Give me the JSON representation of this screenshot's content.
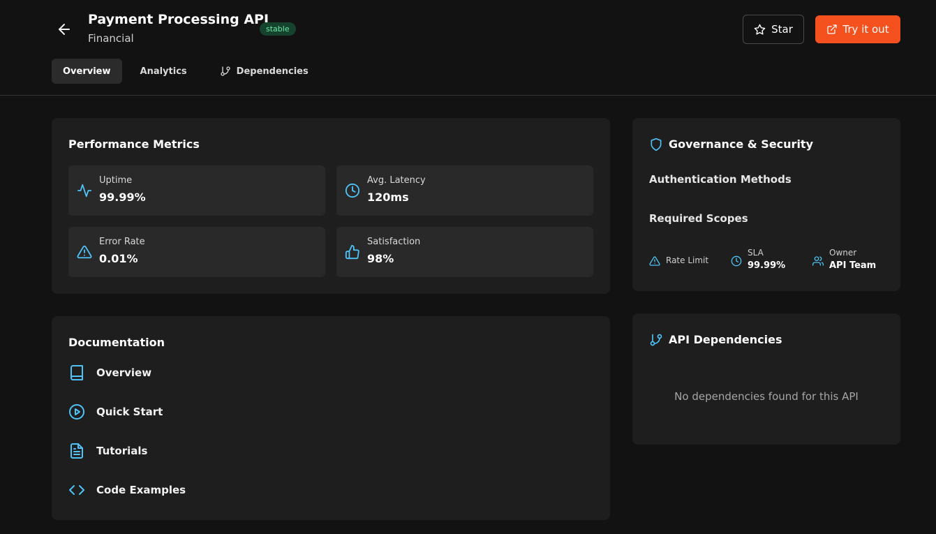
{
  "header": {
    "title": "Payment Processing API",
    "status_badge": "stable",
    "category": "Financial",
    "star_label": "Star",
    "try_label": "Try it out"
  },
  "tabs": [
    {
      "label": "Overview",
      "active": true
    },
    {
      "label": "Analytics",
      "active": false
    },
    {
      "label": "Dependencies",
      "active": false,
      "icon": "git-branch-icon"
    }
  ],
  "performance": {
    "title": "Performance Metrics",
    "metrics": [
      {
        "label": "Uptime",
        "value": "99.99%",
        "icon": "activity-icon"
      },
      {
        "label": "Avg. Latency",
        "value": "120ms",
        "icon": "clock-icon"
      },
      {
        "label": "Error Rate",
        "value": "0.01%",
        "icon": "alert-triangle-icon"
      },
      {
        "label": "Satisfaction",
        "value": "98%",
        "icon": "thumbs-up-icon"
      }
    ]
  },
  "documentation": {
    "title": "Documentation",
    "items": [
      {
        "label": "Overview",
        "icon": "book-icon"
      },
      {
        "label": "Quick Start",
        "icon": "play-circle-icon"
      },
      {
        "label": "Tutorials",
        "icon": "file-text-icon"
      },
      {
        "label": "Code Examples",
        "icon": "code-icon"
      }
    ]
  },
  "governance": {
    "title": "Governance & Security",
    "auth_heading": "Authentication Methods",
    "scopes_heading": "Required Scopes",
    "rate_limit_label": "Rate Limit",
    "sla_label": "SLA",
    "sla_value": "99.99%",
    "owner_label": "Owner",
    "owner_value": "API Team"
  },
  "dependencies": {
    "title": "API Dependencies",
    "empty_message": "No dependencies found for this API"
  },
  "colors": {
    "background": "#121212",
    "card": "#1e1e1e",
    "accent": "#4fc3f7",
    "primary_button": "#f4511e",
    "badge_bg": "#16432d",
    "badge_text": "#6ee7a3"
  }
}
